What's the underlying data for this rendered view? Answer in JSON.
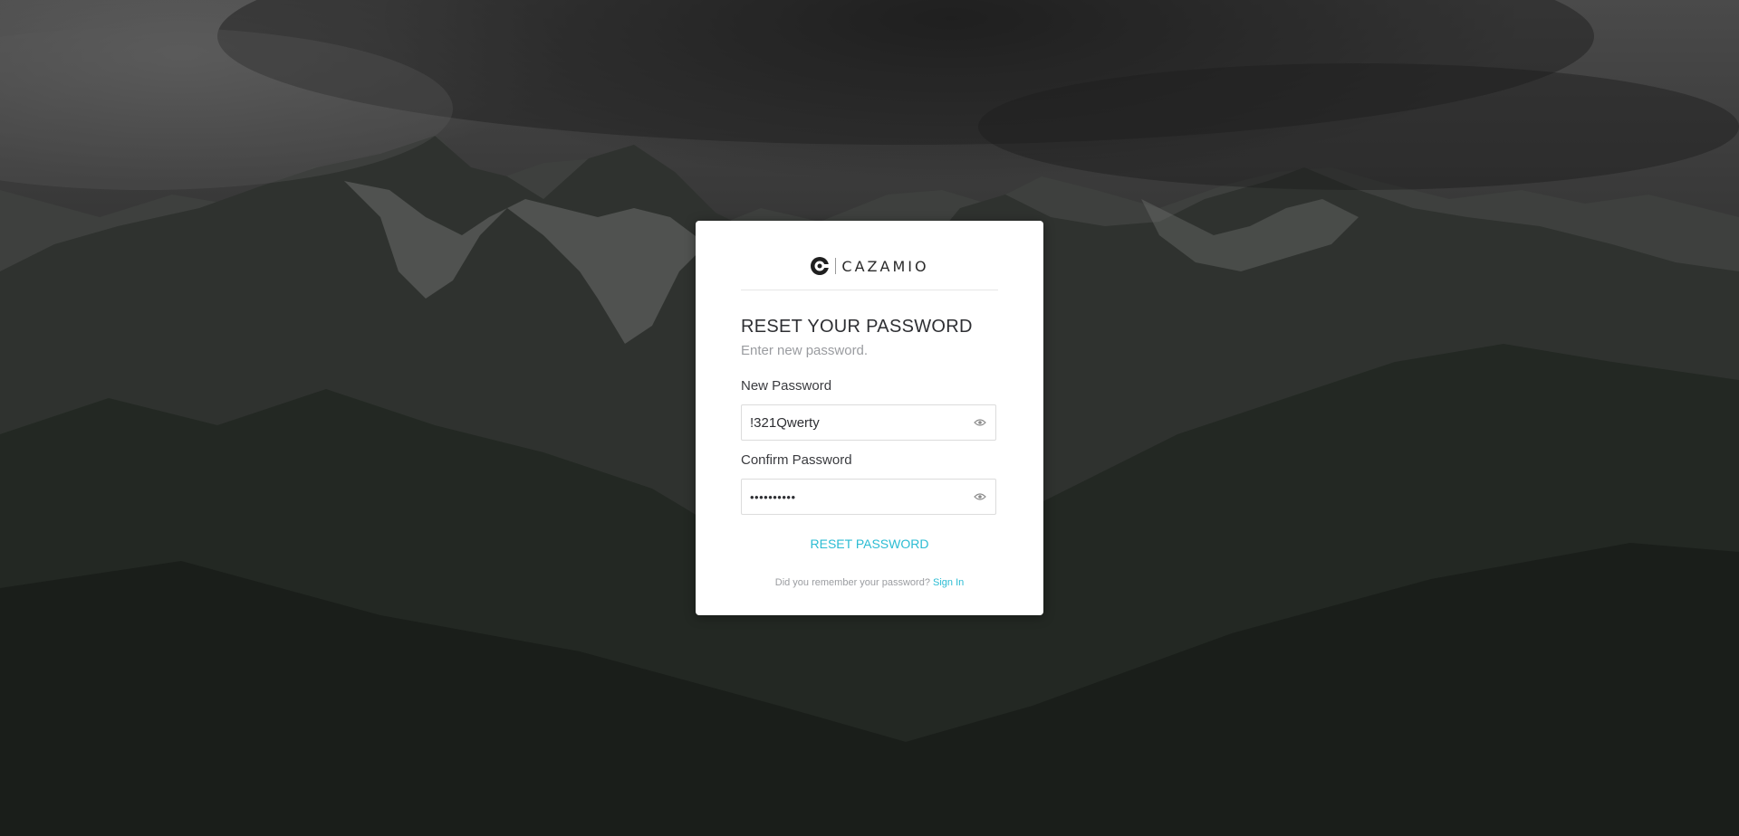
{
  "brand": {
    "name": "CAZAMIO",
    "logo_icon": "cazamio-logo-icon"
  },
  "form": {
    "title": "RESET YOUR PASSWORD",
    "subtitle": "Enter new password.",
    "new_password": {
      "label": "New Password",
      "value": "!321Qwerty",
      "toggle_icon": "eye-icon"
    },
    "confirm_password": {
      "label": "Confirm Password",
      "value": "••••••••••",
      "toggle_icon": "eye-icon"
    },
    "submit_label": "RESET PASSWORD",
    "footer_text": "Did you remember your password?",
    "footer_link": "Sign In"
  },
  "colors": {
    "accent": "#2bbcd3",
    "card_bg": "#ffffff",
    "text": "#2e2f33",
    "muted": "#9a9ca0"
  }
}
